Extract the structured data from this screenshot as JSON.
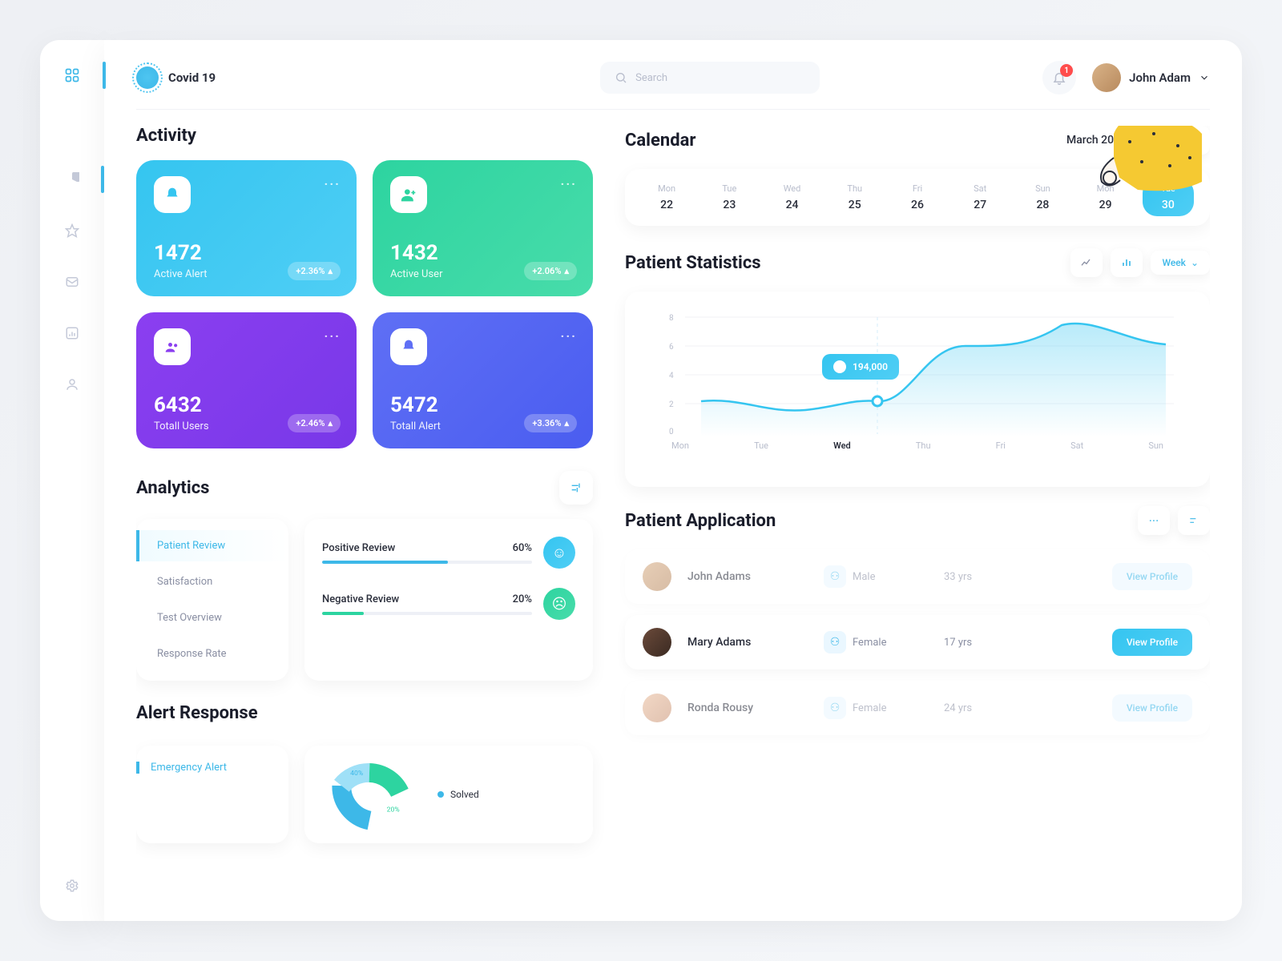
{
  "header": {
    "app": "Covid 19",
    "search_placeholder": "Search",
    "notif_count": "1",
    "user_name": "John Adam"
  },
  "sidebar": {
    "items": [
      "grid",
      "pie",
      "star",
      "mail",
      "chart",
      "person"
    ],
    "footer": "settings"
  },
  "activity": {
    "title": "Activity",
    "cards": [
      {
        "value": "1472",
        "label": "Active Alert",
        "delta": "+2.36%"
      },
      {
        "value": "1432",
        "label": "Active User",
        "delta": "+2.06%"
      },
      {
        "value": "6432",
        "label": "Totall Users",
        "delta": "+2.46%"
      },
      {
        "value": "5472",
        "label": "Totall Alert",
        "delta": "+3.36%"
      }
    ]
  },
  "analytics": {
    "title": "Analytics",
    "tabs": [
      "Patient Review",
      "Satisfaction",
      "Test Overview",
      "Response Rate"
    ],
    "positive_label": "Positive Review",
    "positive_pct": "60%",
    "negative_label": "Negative Review",
    "negative_pct": "20%"
  },
  "alert": {
    "title": "Alert Response",
    "tab": "Emergency Alert",
    "legend": [
      "Solved"
    ],
    "donut_labels": [
      "40%",
      "20%"
    ]
  },
  "calendar": {
    "title": "Calendar",
    "month": "March 2020",
    "days": [
      {
        "dow": "Mon",
        "num": "22"
      },
      {
        "dow": "Tue",
        "num": "23"
      },
      {
        "dow": "Wed",
        "num": "24"
      },
      {
        "dow": "Thu",
        "num": "25"
      },
      {
        "dow": "Fri",
        "num": "26"
      },
      {
        "dow": "Sat",
        "num": "27"
      },
      {
        "dow": "Sun",
        "num": "28"
      },
      {
        "dow": "Mon",
        "num": "29"
      },
      {
        "dow": "Tue",
        "num": "30"
      }
    ]
  },
  "stats": {
    "title": "Patient Statistics",
    "period": "Week",
    "tooltip": "194,000",
    "y": [
      "8",
      "6",
      "4",
      "2",
      "0"
    ],
    "x": [
      "Mon",
      "Tue",
      "Wed",
      "Thu",
      "Fri",
      "Sat",
      "Sun"
    ]
  },
  "patients": {
    "title": "Patient Application",
    "rows": [
      {
        "name": "John Adams",
        "gender": "Male",
        "age": "33 yrs",
        "btn": "View Profile"
      },
      {
        "name": "Mary Adams",
        "gender": "Female",
        "age": "17 yrs",
        "btn": "View Profile"
      },
      {
        "name": "Ronda Rousy",
        "gender": "Female",
        "age": "24 yrs",
        "btn": "View Profile"
      }
    ]
  },
  "chart_data": {
    "type": "area",
    "x": [
      "Mon",
      "Tue",
      "Wed",
      "Thu",
      "Fri",
      "Sat",
      "Sun"
    ],
    "values": [
      2.2,
      1.8,
      2.3,
      6.0,
      6.0,
      7.8,
      6.2
    ],
    "ylim": [
      0,
      8
    ],
    "highlight": {
      "x": "Wed",
      "label": "194,000"
    },
    "title": "Patient Statistics",
    "period": "Week"
  }
}
